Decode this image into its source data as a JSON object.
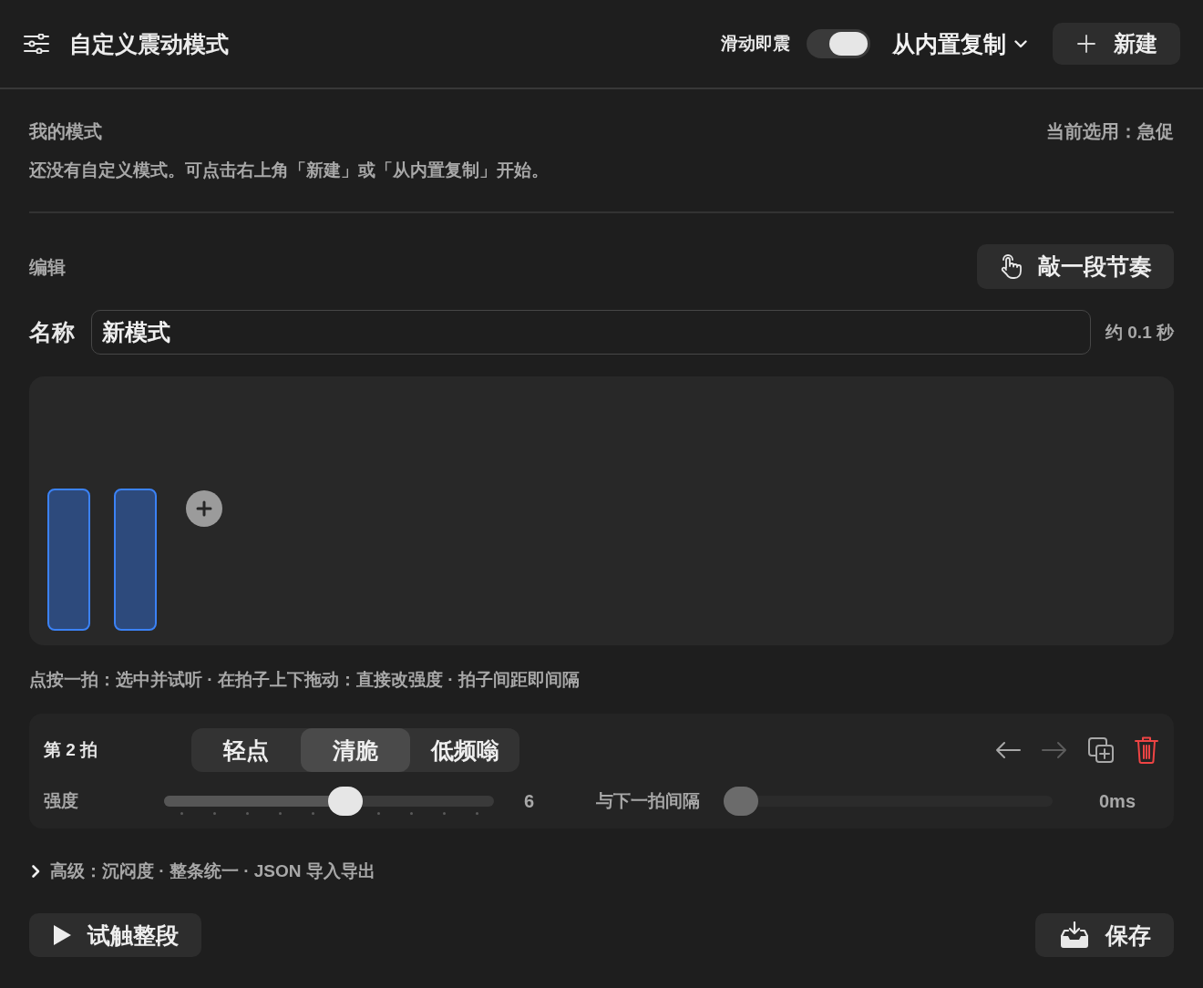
{
  "header": {
    "title": "自定义震动模式",
    "swipe_toggle": {
      "label": "滑动即震",
      "on": true
    },
    "copy_menu": {
      "label": "从内置复制"
    },
    "new_button": {
      "label": "新建"
    }
  },
  "my_patterns": {
    "heading": "我的模式",
    "current": "当前选用：急促",
    "empty_message": "还没有自定义模式。可点击右上角「新建」或「从内置复制」开始。"
  },
  "editor": {
    "heading": "编辑",
    "tap_button": {
      "label": "敲一段节奏"
    },
    "name_field": {
      "label": "名称",
      "value": "新模式"
    },
    "duration": "约 0.1 秒",
    "beats": [
      {
        "kind": "tap"
      },
      {
        "kind": "tap"
      }
    ],
    "hint": "点按一拍：选中并试听 · 在拍子上下拖动：直接改强度 · 拍子间距即间隔"
  },
  "beat_panel": {
    "title": "第 2 拍",
    "types": [
      {
        "label": "轻点",
        "selected": false
      },
      {
        "label": "清脆",
        "selected": true
      },
      {
        "label": "低频嗡",
        "selected": false
      }
    ],
    "actions": [
      {
        "kind": "previous",
        "disabled": false
      },
      {
        "kind": "next",
        "disabled": true
      },
      {
        "kind": "duplicate",
        "disabled": false
      },
      {
        "kind": "delete",
        "disabled": false
      }
    ],
    "sliders": [
      {
        "kind": "stepped",
        "label": "强度",
        "level": 0.556,
        "reading": "6",
        "disabled": false
      },
      {
        "kind": "continuous",
        "label": "与下一拍间隔",
        "level": 0,
        "reading": "0ms",
        "disabled": true
      }
    ]
  },
  "advanced": {
    "label": "高级：沉闷度 · 整条统一 · JSON 导入导出",
    "expanded": false
  },
  "footer_buttons": [
    {
      "kind": "play",
      "label": "试触整段"
    },
    {
      "kind": "save",
      "label": "保存"
    }
  ]
}
